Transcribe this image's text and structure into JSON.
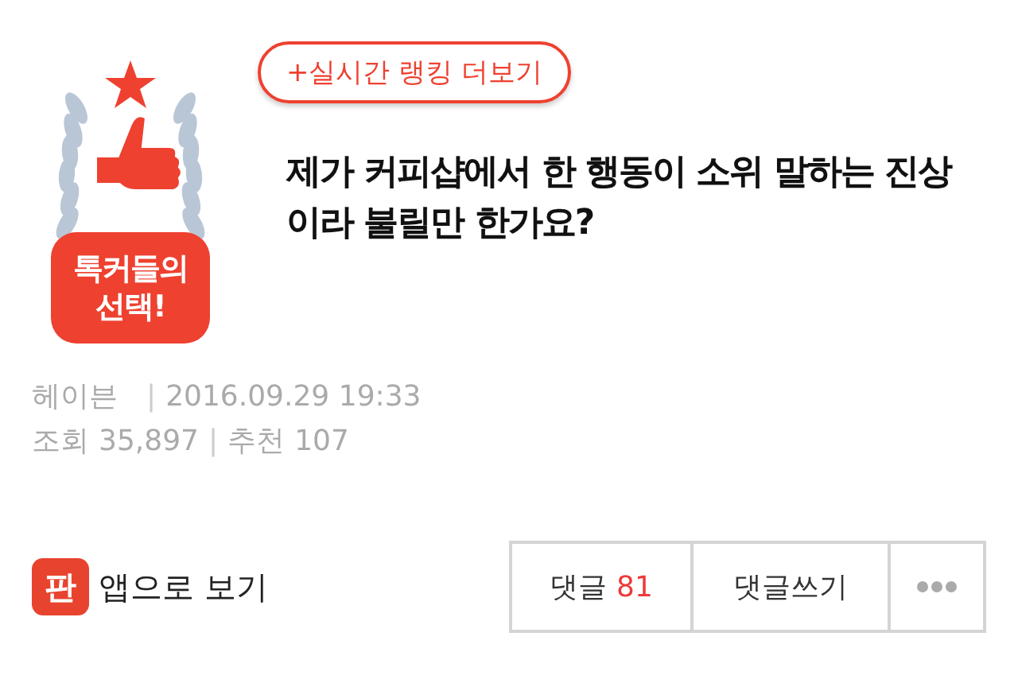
{
  "badge": {
    "lines": [
      "톡커들의",
      "선택!"
    ]
  },
  "ranking_link": "+실시간 랭킹 더보기",
  "title": "제가 커피샵에서 한 행동이 소위 말하는 진상이라 불릴만 한가요?",
  "meta": {
    "author": "헤이븐",
    "separator": "|",
    "date": "2016.09.29 19:33",
    "views_label": "조회",
    "views": "35,897",
    "recommend_label": "추천",
    "recommend": "107"
  },
  "app_link": {
    "icon_text": "판",
    "label": "앱으로 보기"
  },
  "comment_button": {
    "label": "댓글",
    "count": "81"
  },
  "write_button": "댓글쓰기"
}
